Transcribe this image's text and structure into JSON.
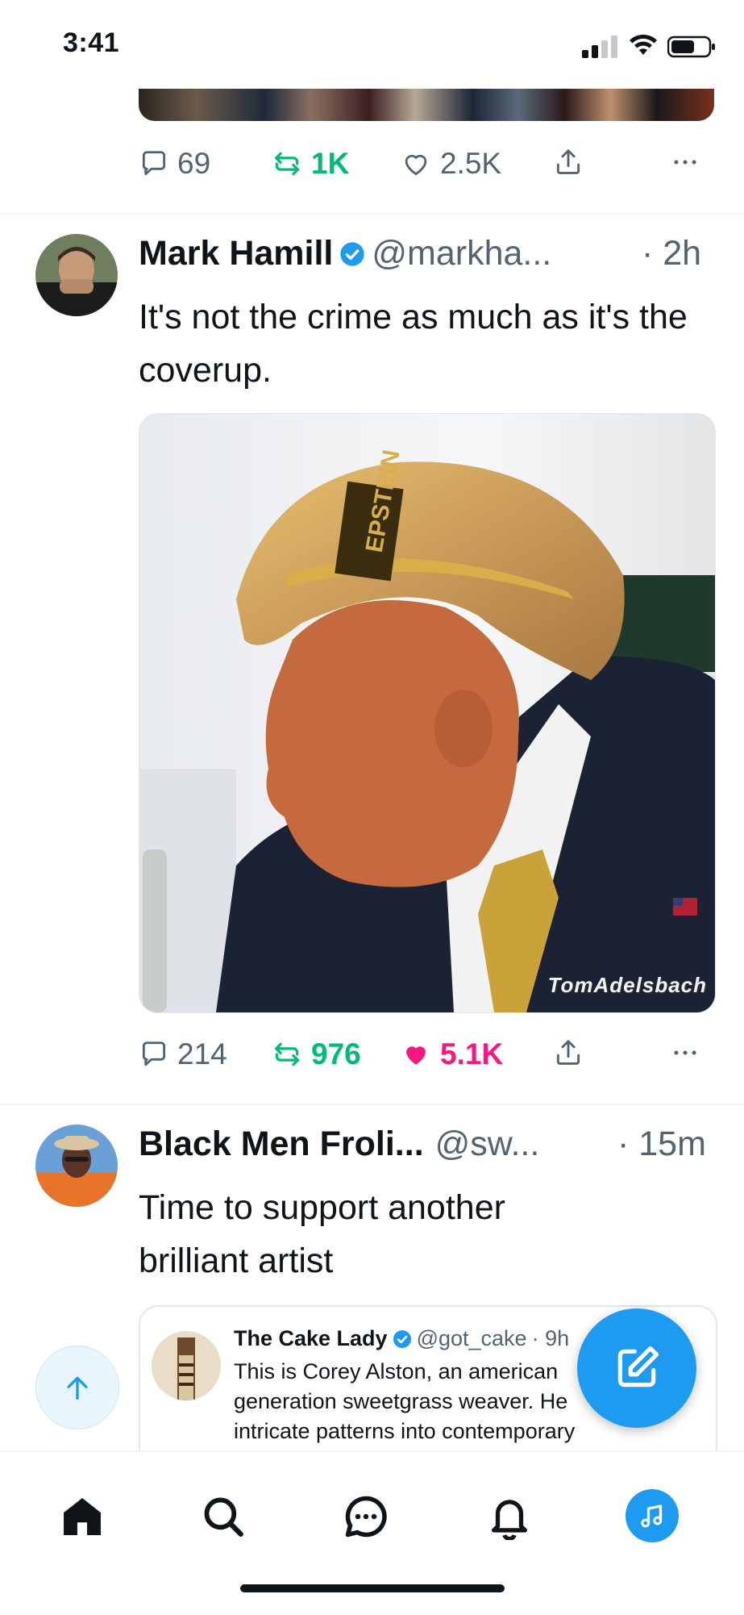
{
  "status_bar": {
    "time": "3:41"
  },
  "prev_tweet": {
    "actions": {
      "replies": "69",
      "retweets": "1K",
      "likes": "2.5K"
    }
  },
  "tweet": {
    "author": "Mark Hamill",
    "handle": "@markha...",
    "time": "· 2h",
    "text": "It's not the crime as much as it's the coverup.",
    "image_label": "EPSTEIN",
    "watermark": "TomAdelsbach",
    "actions": {
      "replies": "214",
      "retweets": "976",
      "likes": "5.1K"
    },
    "colors": {
      "retweet": "#00ba7c",
      "like": "#f91880",
      "verified": "#1d9bf0"
    }
  },
  "tweet2": {
    "author": "Black Men Froli...",
    "handle": "@sw...",
    "time": "· 15m",
    "text": "Time to support another brilliant artist",
    "quote": {
      "author": "The Cake Lady",
      "handle": "@got_cake",
      "time": "· 9h",
      "text_lines": [
        "This is Corey Alston, an american",
        "generation sweetgrass weaver. He",
        "intricate patterns into contemporary"
      ]
    }
  },
  "nav": {
    "items": [
      "home-icon",
      "search-icon",
      "messages-icon",
      "notifications-icon",
      "spaces-icon"
    ]
  }
}
